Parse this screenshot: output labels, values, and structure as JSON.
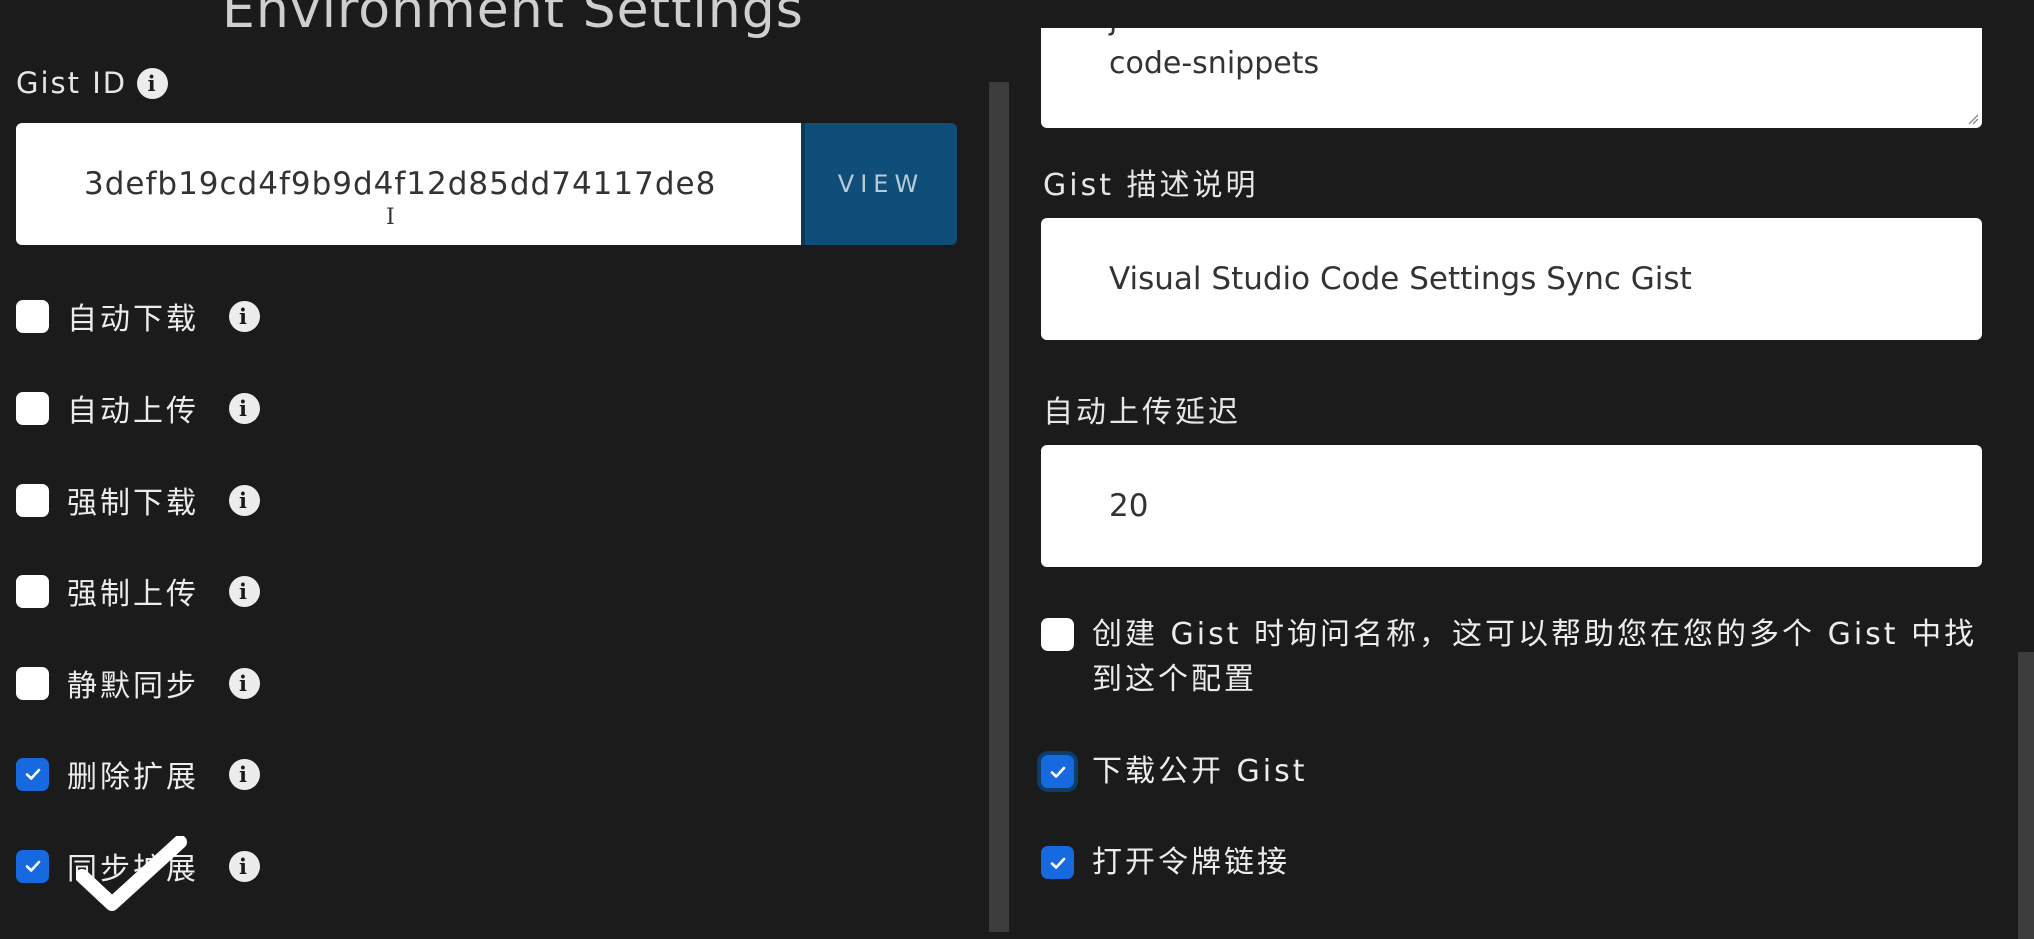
{
  "header": {
    "title": "Environment Settings"
  },
  "gist": {
    "label": "Gist ID",
    "value": "3defb19cd4f9b9d4f12d85dd74117de8",
    "view_label": "VIEW"
  },
  "left_options": [
    {
      "label": "自动下载",
      "checked": false
    },
    {
      "label": "自动上传",
      "checked": false
    },
    {
      "label": "强制下载",
      "checked": false
    },
    {
      "label": "强制上传",
      "checked": false
    },
    {
      "label": "静默同步",
      "checked": false
    },
    {
      "label": "删除扩展",
      "checked": true
    },
    {
      "label": "同步扩展",
      "checked": true
    }
  ],
  "right": {
    "textarea_prev_line": "j",
    "textarea_value": "code-snippets",
    "description_label": "Gist 描述说明",
    "description_value": "Visual Studio Code Settings Sync Gist",
    "delay_label": "自动上传延迟",
    "delay_value": "20",
    "options": [
      {
        "label": "创建 Gist 时询问名称，这可以帮助您在您的多个 Gist 中找到这个配置",
        "checked": false
      },
      {
        "label": "下载公开 Gist",
        "checked": true
      },
      {
        "label": "打开令牌链接",
        "checked": true
      }
    ]
  },
  "colors": {
    "background": "#1b1b1b",
    "accent_checkbox": "#1769e0",
    "view_button": "#0e4e78"
  }
}
